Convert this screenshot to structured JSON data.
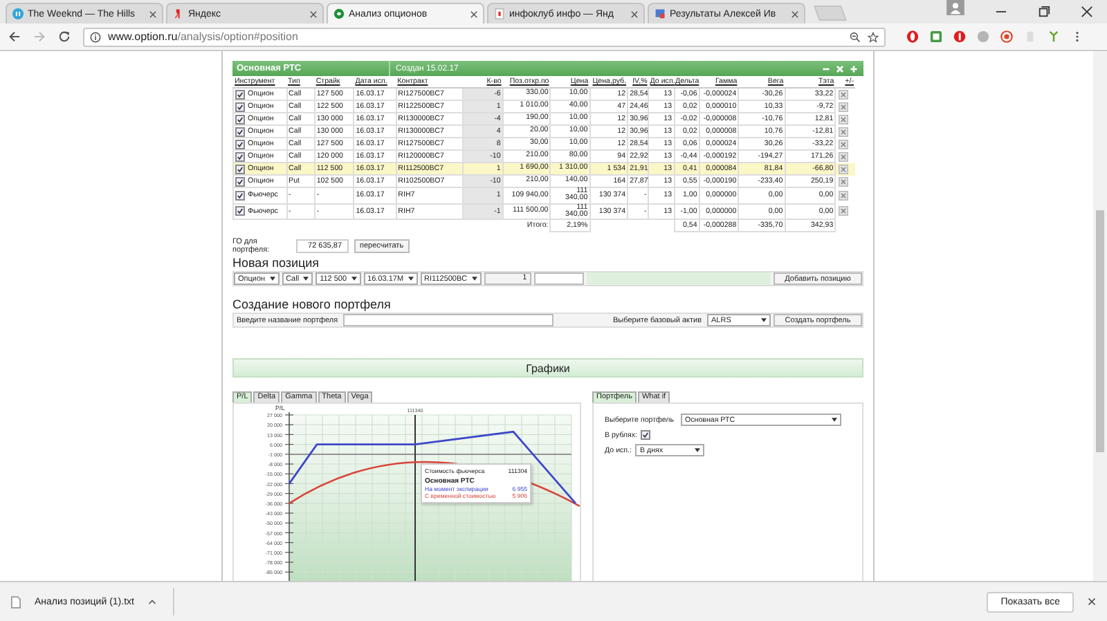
{
  "browser": {
    "tabs": [
      {
        "title": "The Weeknd — The Hills",
        "kind": "media",
        "selected": false
      },
      {
        "title": "Яндекс",
        "kind": "yandex",
        "selected": false
      },
      {
        "title": "Анализ опционов",
        "kind": "site",
        "selected": true
      },
      {
        "title": "инфоклуб инфо — Янд",
        "kind": "yandex-doc",
        "selected": false
      },
      {
        "title": "Результаты Алексей Ив",
        "kind": "doc",
        "selected": false
      }
    ],
    "address": {
      "domain": "www.option.ru",
      "path": "/analysis/option#position"
    }
  },
  "portfolio": {
    "name": "Основная РТС",
    "created": "Создан 15.02.17",
    "columns": [
      "Инструмент",
      "Тип",
      "Страйк",
      "Дата исп.",
      "Контракт",
      "К-во",
      "Поз.откр.по",
      "Цена",
      "Цена,руб.",
      "IV,%",
      "До исп.",
      "Дельта",
      "Гамма",
      "Вега",
      "Тэта",
      "+/-"
    ],
    "rows": [
      {
        "checked": true,
        "selected": false,
        "cells": [
          "Опцион",
          "Call",
          "127 500",
          "16.03.17",
          "RI127500BC7",
          "-6",
          "330,00",
          "10,00",
          "12",
          "28,54",
          "13",
          "-0,06",
          "-0,000024",
          "-30,26",
          "33,22"
        ]
      },
      {
        "checked": true,
        "selected": false,
        "cells": [
          "Опцион",
          "Call",
          "122 500",
          "16.03.17",
          "RI122500BC7",
          "1",
          "1 010,00",
          "40,00",
          "47",
          "24,46",
          "13",
          "0,02",
          "0,000010",
          "10,33",
          "-9,72"
        ]
      },
      {
        "checked": true,
        "selected": false,
        "cells": [
          "Опцион",
          "Call",
          "130 000",
          "16.03.17",
          "RI130000BC7",
          "-4",
          "190,00",
          "10,00",
          "12",
          "30,96",
          "13",
          "-0,02",
          "-0,000008",
          "-10,76",
          "12,81"
        ]
      },
      {
        "checked": true,
        "selected": false,
        "cells": [
          "Опцион",
          "Call",
          "130 000",
          "16.03.17",
          "RI130000BC7",
          "4",
          "20,00",
          "10,00",
          "12",
          "30,96",
          "13",
          "0,02",
          "0,000008",
          "10,76",
          "-12,81"
        ]
      },
      {
        "checked": true,
        "selected": false,
        "cells": [
          "Опцион",
          "Call",
          "127 500",
          "16.03.17",
          "RI127500BC7",
          "8",
          "30,00",
          "10,00",
          "12",
          "28,54",
          "13",
          "0,06",
          "0,000024",
          "30,26",
          "-33,22"
        ]
      },
      {
        "checked": true,
        "selected": false,
        "cells": [
          "Опцион",
          "Call",
          "120 000",
          "16.03.17",
          "RI120000BC7",
          "-10",
          "210,00",
          "80,00",
          "94",
          "22,92",
          "13",
          "-0,44",
          "-0,000192",
          "-194,27",
          "171,26"
        ]
      },
      {
        "checked": true,
        "selected": true,
        "cells": [
          "Опцион",
          "Call",
          "112 500",
          "16.03.17",
          "RI112500BC7",
          "1",
          "1 690,00",
          "1 310,00",
          "1 534",
          "21,91",
          "13",
          "0,41",
          "0,000084",
          "81,84",
          "-66,80"
        ]
      },
      {
        "checked": true,
        "selected": false,
        "cells": [
          "Опцион",
          "Put",
          "102 500",
          "16.03.17",
          "RI102500BO7",
          "-10",
          "210,00",
          "140,00",
          "164",
          "27,87",
          "13",
          "0,55",
          "-0,000190",
          "-233,40",
          "250,19"
        ]
      },
      {
        "checked": true,
        "selected": false,
        "cells": [
          "Фьючерс",
          "-",
          "-",
          "16.03.17",
          "RIH7",
          "1",
          "109 940,00",
          "111 340,00",
          "130 374",
          "-",
          "13",
          "1,00",
          "0,000000",
          "0,00",
          "0,00"
        ]
      },
      {
        "checked": true,
        "selected": false,
        "cells": [
          "Фьючерс",
          "-",
          "-",
          "16.03.17",
          "RIH7",
          "-1",
          "111 500,00",
          "111 340,00",
          "130 374",
          "-",
          "13",
          "-1,00",
          "0,000000",
          "0,00",
          "0,00"
        ]
      }
    ],
    "totals": {
      "label": "Итого:",
      "iv": "2,19%",
      "delta": "0,54",
      "gamma": "-0,000288",
      "vega": "-335,70",
      "theta": "342,93"
    }
  },
  "margin": {
    "label": "ГО для портфеля:",
    "value": "72 635,87",
    "button": "пересчитать"
  },
  "new_position": {
    "title": "Новая позиция",
    "selects": [
      "Опцион",
      "Call",
      "112 500",
      "16.03.17M",
      "RI112500BC"
    ],
    "quantity": "1",
    "button": "Добавить позицию"
  },
  "new_portfolio": {
    "title": "Создание нового портфеля",
    "name_label": "Введите название портфеля",
    "asset_label": "Выберите базовый актив",
    "asset": "ALRS",
    "button": "Создать портфель"
  },
  "charts": {
    "title": "Графики",
    "tabs": [
      {
        "label": "P/L",
        "selected": true
      },
      {
        "label": "Delta",
        "selected": false
      },
      {
        "label": "Gamma",
        "selected": false
      },
      {
        "label": "Theta",
        "selected": false
      },
      {
        "label": "Vega",
        "selected": false
      }
    ],
    "plot": {
      "ylabel": "P/L",
      "x_marker": "111340",
      "y_axis_labels": [
        "27 000",
        "20 000",
        "13 000",
        "6 000",
        "-1 000",
        "-8 000",
        "-15 000",
        "-22 000",
        "-29 000",
        "-36 000",
        "-43 000",
        "-50 000",
        "-57 000",
        "-64 000",
        "-71 000",
        "-78 000",
        "-85 000"
      ],
      "tooltip": {
        "label": "Стоимость фьючерса",
        "value": "111304",
        "title": "Основная РТС",
        "lines": [
          {
            "label": "На момент экспирации",
            "value": "6 955",
            "color": "#3f48c8"
          },
          {
            "label": "С временной стоимостью",
            "value": "5 906",
            "color": "#d9443a"
          }
        ]
      }
    },
    "side_tabs": [
      {
        "label": "Портфель",
        "selected": true
      },
      {
        "label": "What if",
        "selected": false
      }
    ],
    "settings": {
      "portfolio_label": "Выберите портфель",
      "portfolio": "Основная РТС",
      "rub_label": "В рублях:",
      "rub_checked": true,
      "expiry_label": "До исп.:",
      "expiry": "В днях"
    }
  },
  "downloads": {
    "file": "Анализ позиций (1).txt",
    "show_all": "Показать все"
  }
}
